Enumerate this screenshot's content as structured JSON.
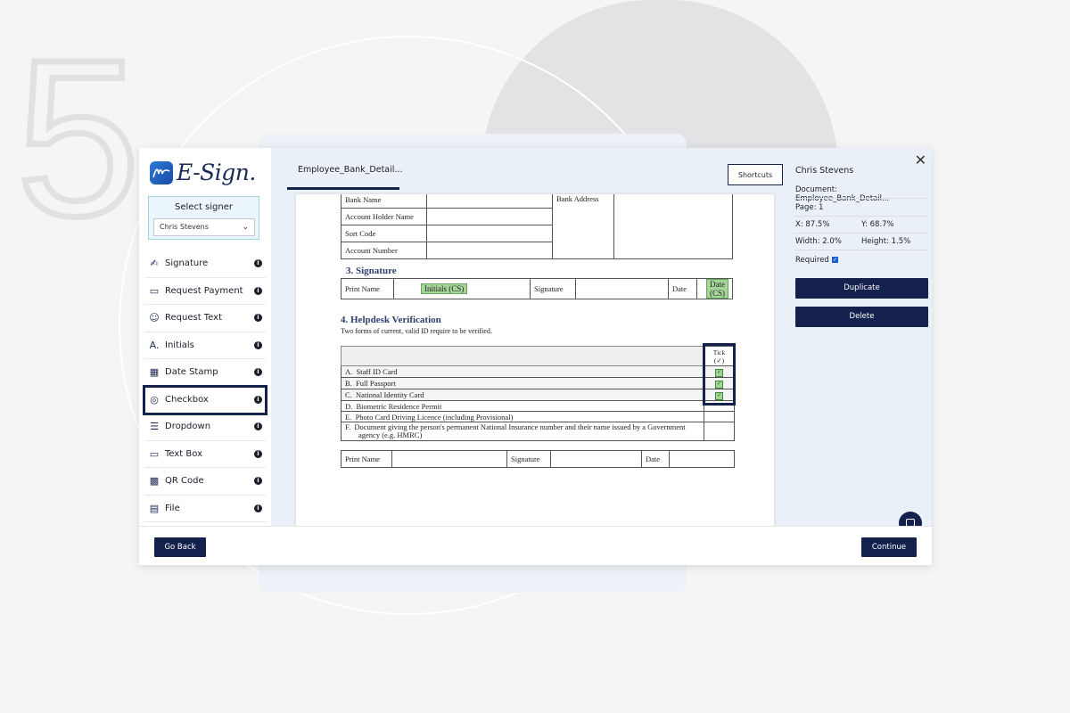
{
  "background": {
    "step_number": "5"
  },
  "app": {
    "logo_text": "E-Sign.",
    "signer": {
      "label": "Select signer",
      "selected": "Chris Stevens"
    },
    "tools": [
      {
        "label": "Signature",
        "icon": "signature-icon"
      },
      {
        "label": "Request Payment",
        "icon": "card-icon"
      },
      {
        "label": "Request Text",
        "icon": "person-text-icon"
      },
      {
        "label": "Initials",
        "icon": "initials-icon"
      },
      {
        "label": "Date Stamp",
        "icon": "calendar-icon"
      },
      {
        "label": "Checkbox",
        "icon": "checkbox-icon"
      },
      {
        "label": "Dropdown",
        "icon": "dropdown-icon"
      },
      {
        "label": "Text Box",
        "icon": "textbox-icon"
      },
      {
        "label": "QR Code",
        "icon": "qr-icon"
      },
      {
        "label": "File",
        "icon": "file-icon"
      }
    ],
    "tab_label": "Employee_Bank_Detail...",
    "shortcuts_label": "Shortcuts",
    "document": {
      "bank_table": {
        "rows": [
          "Bank Name",
          "Account Holder Name",
          "Sort Code",
          "Account Number"
        ],
        "address_label": "Bank Address"
      },
      "section3": {
        "title": "3. Signature",
        "print_name": "Print Name",
        "initials_field": "Initials (CS)",
        "signature": "Signature",
        "date": "Date",
        "date_field": "Date (CS)"
      },
      "section4": {
        "title": "4. Helpdesk Verification",
        "subtitle": "Two forms of current, valid ID require to be verified.",
        "tick_header": "Tick (✓)",
        "items": [
          {
            "letter": "A.",
            "text": "Staff ID Card",
            "ticked": true
          },
          {
            "letter": "B.",
            "text": "Full Passport",
            "ticked": true
          },
          {
            "letter": "C.",
            "text": "National Identity Card",
            "ticked": true
          },
          {
            "letter": "D.",
            "text": "Biometric Residence Permit",
            "ticked": false
          },
          {
            "letter": "E.",
            "text": "Photo Card Driving Licence (including Provisional)",
            "ticked": false
          },
          {
            "letter": "F.",
            "text": "Document giving the person's permanent National Insurance number and their name issued by a Government agency (e.g. HMRC)",
            "ticked": false
          }
        ],
        "print_name": "Print Name",
        "signature": "Signature",
        "date": "Date"
      }
    },
    "properties": {
      "name": "Chris Stevens",
      "document": "Document: Employee_Bank_Detail...",
      "page": "Page: 1",
      "x": "X: 87.5%",
      "y": "Y: 68.7%",
      "width": "Width: 2.0%",
      "height": "Height: 1.5%",
      "required_label": "Required",
      "required": true,
      "duplicate_label": "Duplicate",
      "delete_label": "Delete"
    },
    "footer": {
      "back_label": "Go Back",
      "continue_label": "Continue"
    },
    "colors": {
      "navy": "#14214d",
      "field_green": "#a6d59a",
      "panel_bg": "#eaf0f8"
    }
  }
}
